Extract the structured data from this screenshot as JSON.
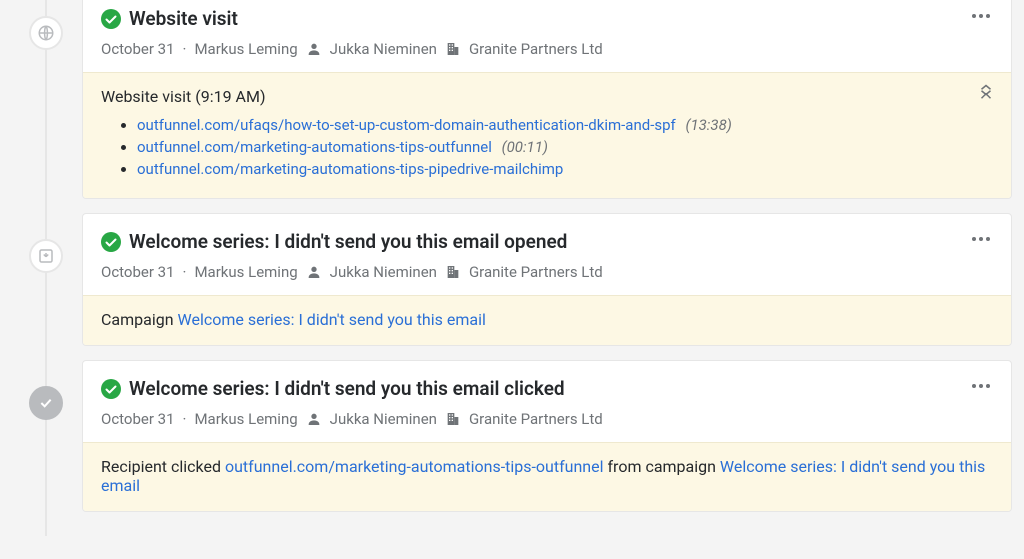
{
  "entries": [
    {
      "title": "Website visit",
      "date": "October 31",
      "owner": "Markus Leming",
      "person": "Jukka Nieminen",
      "org": "Granite Partners Ltd",
      "detail_head": "Website visit (9:19 AM)",
      "links": [
        {
          "url": "outfunnel.com/ufaqs/how-to-set-up-custom-domain-authentication-dkim-and-spf",
          "dur": "(13:38)"
        },
        {
          "url": "outfunnel.com/marketing-automations-tips-outfunnel",
          "dur": "(00:11)"
        },
        {
          "url": "outfunnel.com/marketing-automations-tips-pipedrive-mailchimp",
          "dur": ""
        }
      ]
    },
    {
      "title": "Welcome series: I didn't send you this email opened",
      "date": "October 31",
      "owner": "Markus Leming",
      "person": "Jukka Nieminen",
      "org": "Granite Partners Ltd",
      "body_prefix": "Campaign ",
      "body_link": "Welcome series: I didn't send you this email"
    },
    {
      "title": "Welcome series: I didn't send you this email clicked",
      "date": "October 31",
      "owner": "Markus Leming",
      "person": "Jukka Nieminen",
      "org": "Granite Partners Ltd",
      "body_prefix": "Recipient clicked ",
      "body_link": "outfunnel.com/marketing-automations-tips-outfunnel",
      "body_mid": " from campaign ",
      "body_link2": "Welcome series: I didn't send you this email"
    }
  ]
}
